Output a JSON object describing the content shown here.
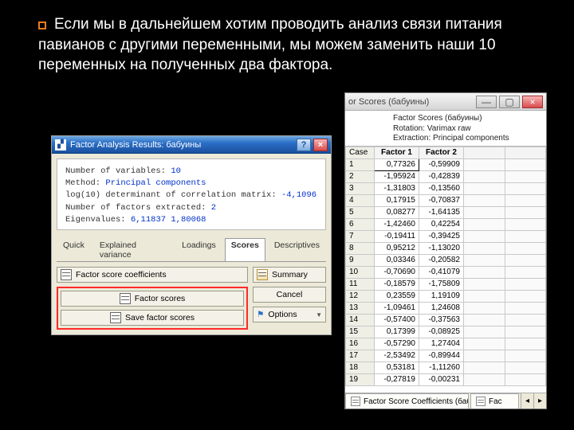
{
  "slide": {
    "text": "Если мы в дальнейшем хотим проводить анализ связи питания павианов с другими переменными, мы можем заменить наши 10 переменных на полученных два фактора."
  },
  "dialog1": {
    "title": "Factor Analysis Results: бабуины",
    "lines": {
      "nvars_label": "Number of variables:",
      "nvars": "10",
      "method_label": "Method:",
      "method": "Principal components",
      "logdet_label": "log(10) determinant of correlation matrix:",
      "logdet": "-4,1096",
      "nfact_label": "Number of factors extracted:",
      "nfact": "2",
      "eig_label": "Eigenvalues:",
      "eig1": "6,11837",
      "eig2": "1,80068"
    },
    "tabs": [
      "Quick",
      "Explained variance",
      "Loadings",
      "Scores",
      "Descriptives"
    ],
    "buttons": {
      "fsc": "Factor score coefficients",
      "fs": "Factor scores",
      "sfs": "Save factor scores",
      "summary": "Summary",
      "cancel": "Cancel",
      "options": "Options"
    }
  },
  "sheet": {
    "title": "or Scores (бабуины)",
    "caption1": "Factor Scores (бабуины)",
    "caption2": "Rotation: Varimax raw",
    "caption3": "Extraction: Principal components",
    "case_label": "Case",
    "col1": "Factor 1",
    "col2": "Factor 2",
    "rows": [
      {
        "n": "1",
        "f1": "0,77326",
        "f2": "-0,59909"
      },
      {
        "n": "2",
        "f1": "-1,95924",
        "f2": "-0,42839"
      },
      {
        "n": "3",
        "f1": "-1,31803",
        "f2": "-0,13560"
      },
      {
        "n": "4",
        "f1": "0,17915",
        "f2": "-0,70837"
      },
      {
        "n": "5",
        "f1": "0,08277",
        "f2": "-1,64135"
      },
      {
        "n": "6",
        "f1": "-1,42460",
        "f2": "0,42254"
      },
      {
        "n": "7",
        "f1": "-0,19411",
        "f2": "-0,39425"
      },
      {
        "n": "8",
        "f1": "0,95212",
        "f2": "-1,13020"
      },
      {
        "n": "9",
        "f1": "0,03346",
        "f2": "-0,20582"
      },
      {
        "n": "10",
        "f1": "-0,70690",
        "f2": "-0,41079"
      },
      {
        "n": "11",
        "f1": "-0,18579",
        "f2": "-1,75809"
      },
      {
        "n": "12",
        "f1": "0,23559",
        "f2": "1,19109"
      },
      {
        "n": "13",
        "f1": "-1,09461",
        "f2": "1,24608"
      },
      {
        "n": "14",
        "f1": "-0,57400",
        "f2": "-0,37563"
      },
      {
        "n": "15",
        "f1": "0,17399",
        "f2": "-0,08925"
      },
      {
        "n": "16",
        "f1": "-0,57290",
        "f2": "1,27404"
      },
      {
        "n": "17",
        "f1": "-2,53492",
        "f2": "-0,89944"
      },
      {
        "n": "18",
        "f1": "0,53181",
        "f2": "-1,11260"
      },
      {
        "n": "19",
        "f1": "-0,27819",
        "f2": "-0,00231"
      }
    ],
    "footer_tab1": "Factor Score Coefficients (бабуины)",
    "footer_tab2": "Fac"
  },
  "chart_data": {
    "type": "table",
    "title": "Factor Scores (бабуины)",
    "columns": [
      "Case",
      "Factor 1",
      "Factor 2"
    ],
    "rows": [
      [
        1,
        0.77326,
        -0.59909
      ],
      [
        2,
        -1.95924,
        -0.42839
      ],
      [
        3,
        -1.31803,
        -0.1356
      ],
      [
        4,
        0.17915,
        -0.70837
      ],
      [
        5,
        0.08277,
        -1.64135
      ],
      [
        6,
        -1.4246,
        0.42254
      ],
      [
        7,
        -0.19411,
        -0.39425
      ],
      [
        8,
        0.95212,
        -1.1302
      ],
      [
        9,
        0.03346,
        -0.20582
      ],
      [
        10,
        -0.7069,
        -0.41079
      ],
      [
        11,
        -0.18579,
        -1.75809
      ],
      [
        12,
        0.23559,
        1.19109
      ],
      [
        13,
        -1.09461,
        1.24608
      ],
      [
        14,
        -0.574,
        -0.37563
      ],
      [
        15,
        0.17399,
        -0.08925
      ],
      [
        16,
        -0.5729,
        1.27404
      ],
      [
        17,
        -2.53492,
        -0.89944
      ],
      [
        18,
        0.53181,
        -1.1126
      ],
      [
        19,
        -0.27819,
        -0.00231
      ]
    ]
  }
}
